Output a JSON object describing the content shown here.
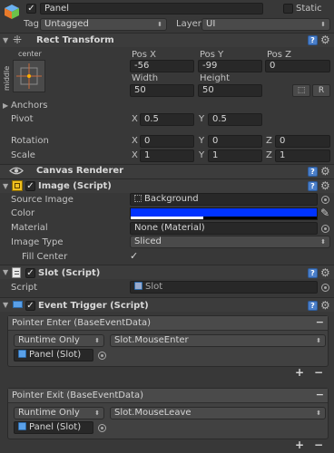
{
  "header": {
    "name_value": "Panel",
    "static_label": "Static",
    "tag_label": "Tag",
    "tag_value": "Untagged",
    "layer_label": "Layer",
    "layer_value": "UI"
  },
  "rect_transform": {
    "title": "Rect Transform",
    "anchor_h": "center",
    "anchor_v": "middle",
    "col1": "Pos X",
    "col2": "Pos Y",
    "col3": "Pos Z",
    "pos_x": "-56",
    "pos_y": "-99",
    "pos_z": "0",
    "width_label": "Width",
    "height_label": "Height",
    "width": "50",
    "height": "50",
    "r_button": "R",
    "anchors_label": "Anchors",
    "pivot_label": "Pivot",
    "pivot_x": "0.5",
    "pivot_y": "0.5",
    "rotation_label": "Rotation",
    "rot_x": "0",
    "rot_y": "0",
    "rot_z": "0",
    "scale_label": "Scale",
    "scale_x": "1",
    "scale_y": "1",
    "scale_z": "1",
    "x": "X",
    "y": "Y",
    "z": "Z"
  },
  "canvas_renderer": {
    "title": "Canvas Renderer"
  },
  "image_script": {
    "title": "Image (Script)",
    "source_image_label": "Source Image",
    "source_image_value": "Background",
    "color_label": "Color",
    "color_value": "#0033ff",
    "material_label": "Material",
    "material_value": "None (Material)",
    "image_type_label": "Image Type",
    "image_type_value": "Sliced",
    "fill_center_label": "Fill Center"
  },
  "slot_script": {
    "title": "Slot (Script)",
    "script_label": "Script",
    "script_value": "Slot"
  },
  "event_trigger": {
    "title": "Event Trigger (Script)",
    "entries": [
      {
        "title": "Pointer Enter (BaseEventData)",
        "mode": "Runtime Only",
        "function": "Slot.MouseEnter",
        "target": "Panel (Slot)"
      },
      {
        "title": "Pointer Exit (BaseEventData)",
        "mode": "Runtime Only",
        "function": "Slot.MouseLeave",
        "target": "Panel (Slot)"
      }
    ],
    "add_label": "+",
    "remove_label": "−"
  }
}
